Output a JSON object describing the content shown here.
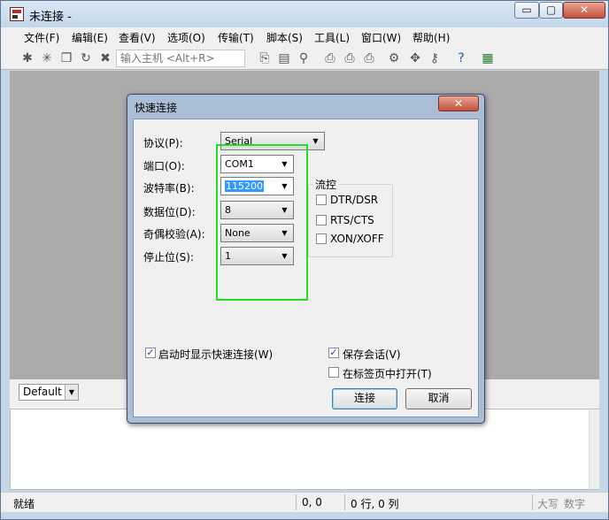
{
  "window": {
    "title": "未连接 -",
    "min_label": "▭",
    "max_label": "▢",
    "close_label": "✕"
  },
  "menu": [
    "文件(F)",
    "编辑(E)",
    "查看(V)",
    "选项(O)",
    "传输(T)",
    "脚本(S)",
    "工具(L)",
    "窗口(W)",
    "帮助(H)"
  ],
  "toolbar": {
    "host_placeholder": "输入主机 <Alt+R>"
  },
  "session": {
    "combo_value": "Default"
  },
  "status": {
    "ready": "就绪",
    "position": "0, 0",
    "rowcol": "0 行, 0 列",
    "caps": "大写",
    "num": "数字"
  },
  "dialog": {
    "title": "快速连接",
    "close_label": "✕",
    "fields": [
      {
        "label": "协议(P):",
        "value": "Serial"
      },
      {
        "label": "端口(O):",
        "value": "COM1"
      },
      {
        "label": "波特率(B):",
        "value": "115200"
      },
      {
        "label": "数据位(D):",
        "value": "8"
      },
      {
        "label": "奇偶校验(A):",
        "value": "None"
      },
      {
        "label": "停止位(S):",
        "value": "1"
      }
    ],
    "flow_control": {
      "title": "流控",
      "options": [
        {
          "label": "DTR/DSR",
          "checked": false
        },
        {
          "label": "RTS/CTS",
          "checked": false
        },
        {
          "label": "XON/XOFF",
          "checked": false
        }
      ]
    },
    "show_on_startup": {
      "label": "启动时显示快速连接(W)",
      "checked": true
    },
    "save_session": {
      "label": "保存会话(V)",
      "checked": true
    },
    "open_in_tab": {
      "label": "在标签页中打开(T)",
      "checked": false
    },
    "connect_label": "连接",
    "cancel_label": "取消",
    "highlight_color": "#22dd22"
  }
}
